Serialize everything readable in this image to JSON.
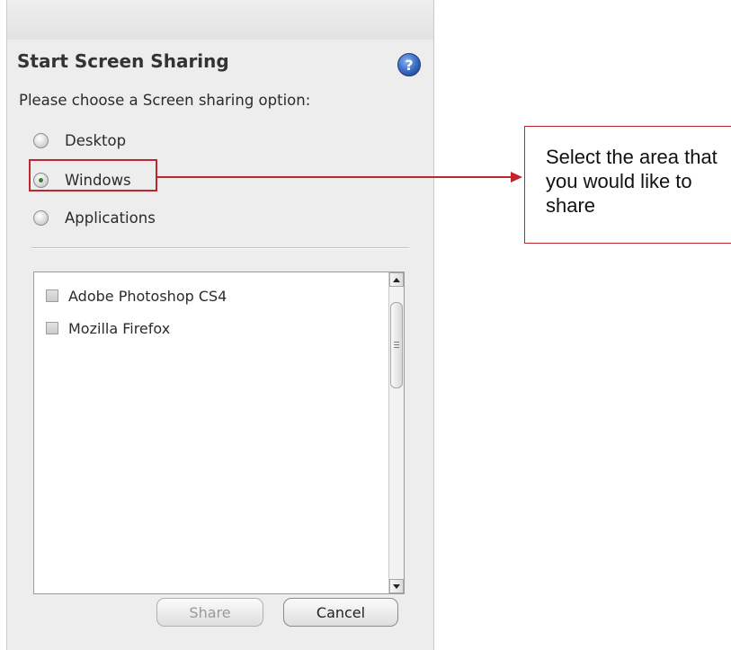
{
  "panel": {
    "title": "Start Screen Sharing",
    "help_icon": "question-mark-help-icon",
    "prompt": "Please choose a Screen sharing option:",
    "options": [
      {
        "label": "Desktop",
        "selected": false
      },
      {
        "label": "Windows",
        "selected": true
      },
      {
        "label": "Applications",
        "selected": false
      }
    ],
    "window_list": [
      {
        "label": "Adobe Photoshop CS4",
        "checked": false
      },
      {
        "label": "Mozilla Firefox",
        "checked": false
      }
    ],
    "buttons": {
      "share_label": "Share",
      "share_enabled": false,
      "cancel_label": "Cancel"
    }
  },
  "annotation": {
    "callout_text": "Select the area that you would like to share",
    "color": "#c0262d"
  },
  "colors": {
    "panel_bg": "#ededed",
    "help_icon": "#3b6fc4",
    "selected_radio_dot": "#3a7d2a"
  }
}
